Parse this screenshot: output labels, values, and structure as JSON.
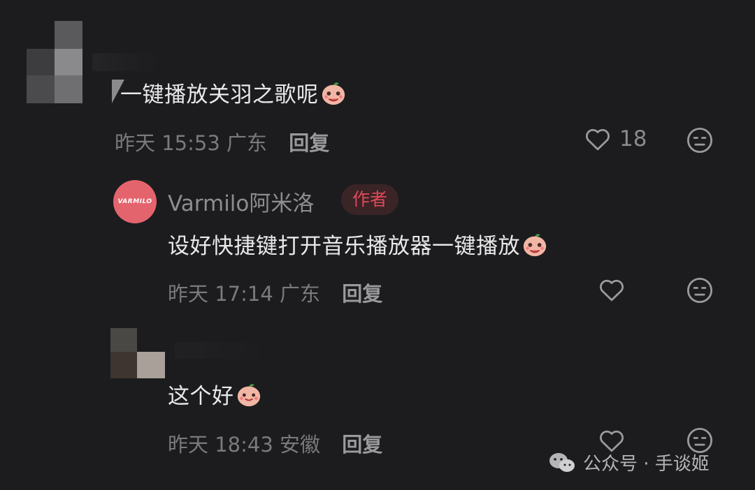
{
  "comment1": {
    "text": "一键播放关羽之歌呢",
    "time": "昨天 15:53",
    "location": "广东",
    "reply_label": "回复",
    "like_count": "18"
  },
  "reply1": {
    "avatar_text": "VARMILO",
    "username": "Varmilo阿米洛",
    "badge": "作者",
    "text": "设好快捷键打开音乐播放器一键播放",
    "time": "昨天 17:14",
    "location": "广东",
    "reply_label": "回复"
  },
  "reply2": {
    "text": "这个好",
    "time": "昨天 18:43",
    "location": "安徽",
    "reply_label": "回复"
  },
  "watermark": {
    "text": "公众号 · 手谈姬"
  },
  "colors": {
    "background": "#1c1c1e",
    "brand_avatar": "#e4646e",
    "author_badge": "#e0495a"
  }
}
